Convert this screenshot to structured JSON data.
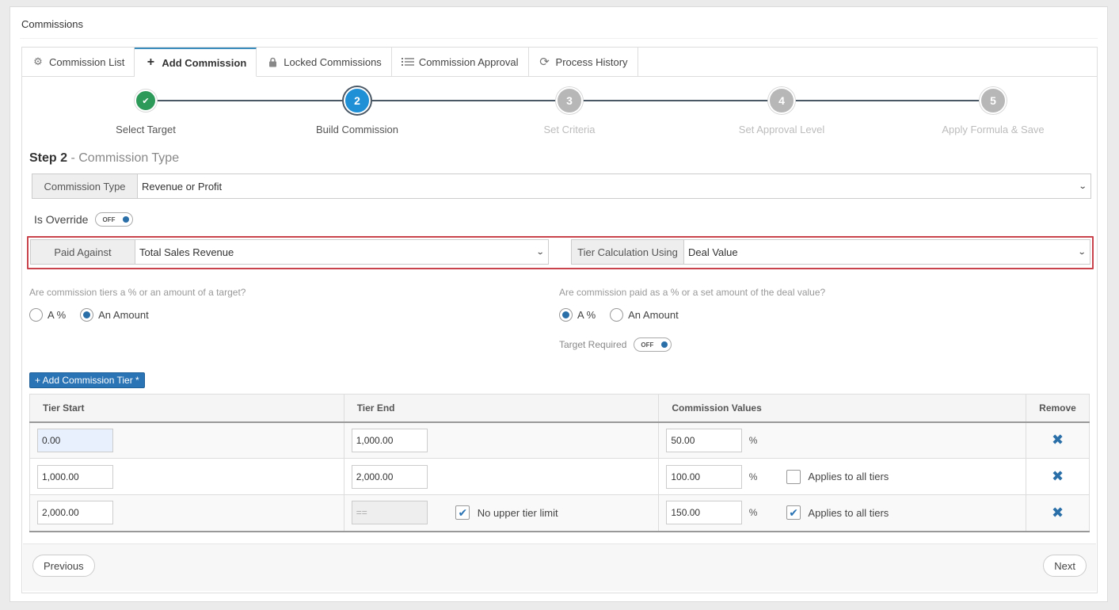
{
  "page": {
    "title": "Commissions"
  },
  "tabs": [
    {
      "label": "Commission List",
      "icon": "gears-icon"
    },
    {
      "label": "Add Commission",
      "icon": "plus-icon",
      "active": true
    },
    {
      "label": "Locked Commissions",
      "icon": "lock-icon"
    },
    {
      "label": "Commission Approval",
      "icon": "list-icon"
    },
    {
      "label": "Process History",
      "icon": "refresh-icon"
    }
  ],
  "steps": [
    {
      "number": "✔",
      "label": "Select Target",
      "state": "done"
    },
    {
      "number": "2",
      "label": "Build Commission",
      "state": "current"
    },
    {
      "number": "3",
      "label": "Set Criteria",
      "state": "todo"
    },
    {
      "number": "4",
      "label": "Set Approval Level",
      "state": "todo"
    },
    {
      "number": "5",
      "label": "Apply Formula & Save",
      "state": "todo"
    }
  ],
  "step_heading": {
    "bold": "Step 2",
    "rest": " - Commission Type"
  },
  "commission_type": {
    "label": "Commission Type",
    "value": "Revenue or Profit"
  },
  "override": {
    "label": "Is Override",
    "state": "OFF"
  },
  "paid_against": {
    "label": "Paid Against",
    "value": "Total Sales Revenue"
  },
  "tier_calc": {
    "label": "Tier Calculation Using",
    "value": "Deal Value"
  },
  "tiers_question": {
    "text": "Are commission tiers a % or an amount of a target?",
    "options": [
      "A %",
      "An Amount"
    ],
    "selected": "An Amount"
  },
  "paid_question": {
    "text": "Are commission paid as a % or a set amount of the deal value?",
    "options": [
      "A %",
      "An Amount"
    ],
    "selected": "A %"
  },
  "target_required": {
    "label": "Target Required",
    "state": "OFF"
  },
  "add_tier_button": "+ Add Commission Tier *",
  "table": {
    "headers": [
      "Tier Start",
      "Tier End",
      "Commission Values",
      "Remove"
    ],
    "rows": [
      {
        "start": "0.00",
        "end": "1,000.00",
        "value": "50.00",
        "unit": "%"
      },
      {
        "start": "1,000.00",
        "end": "2,000.00",
        "value": "100.00",
        "unit": "%",
        "applies_label": "Applies to all tiers",
        "applies": false
      },
      {
        "start": "2,000.00",
        "end": "==",
        "no_limit_label": "No upper tier limit",
        "no_limit": true,
        "value": "150.00",
        "unit": "%",
        "applies_label": "Applies to all tiers",
        "applies": true
      }
    ]
  },
  "footer": {
    "previous": "Previous",
    "next": "Next"
  }
}
